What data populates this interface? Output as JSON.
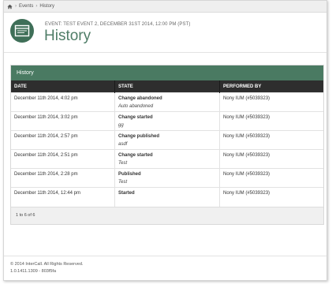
{
  "breadcrumb": {
    "items": [
      "Events",
      "History"
    ]
  },
  "header": {
    "eyebrow": "EVENT: TEST EVENT 2, DECEMBER 31ST 2014, 12:00 PM (PST)",
    "title": "History"
  },
  "panel": {
    "title": "History",
    "columns": [
      "DATE",
      "STATE",
      "PERFORMED BY"
    ],
    "rows": [
      {
        "date": "December 11th 2014, 4:02 pm",
        "state": "Change abandoned",
        "note": "Auto abandoned",
        "by": "Nony IUM (#5039323)"
      },
      {
        "date": "December 11th 2014, 3:02 pm",
        "state": "Change started",
        "note": "gg",
        "by": "Nony IUM (#5039323)"
      },
      {
        "date": "December 11th 2014, 2:57 pm",
        "state": "Change published",
        "note": "asdf",
        "by": "Nony IUM (#5039323)"
      },
      {
        "date": "December 11th 2014, 2:51 pm",
        "state": "Change started",
        "note": "Test",
        "by": "Nony IUM (#5039323)"
      },
      {
        "date": "December 11th 2014, 2:28 pm",
        "state": "Published",
        "note": "Test",
        "by": "Nony IUM (#5039323)"
      },
      {
        "date": "December 11th 2014, 12:44 pm",
        "state": "Started",
        "note": "",
        "by": "Nony IUM (#5039323)"
      }
    ],
    "pager": "1 to 6 of 6"
  },
  "footer": {
    "copyright": "© 2014 InterCall. All Rights Reserved.",
    "version": "1.0.1411.1309 - 803f5fa"
  },
  "colors": {
    "brand": "#4a7a62",
    "header_dark": "#2e2e2e"
  },
  "icons": {
    "home": "home-icon",
    "logo": "browser-window-icon"
  }
}
